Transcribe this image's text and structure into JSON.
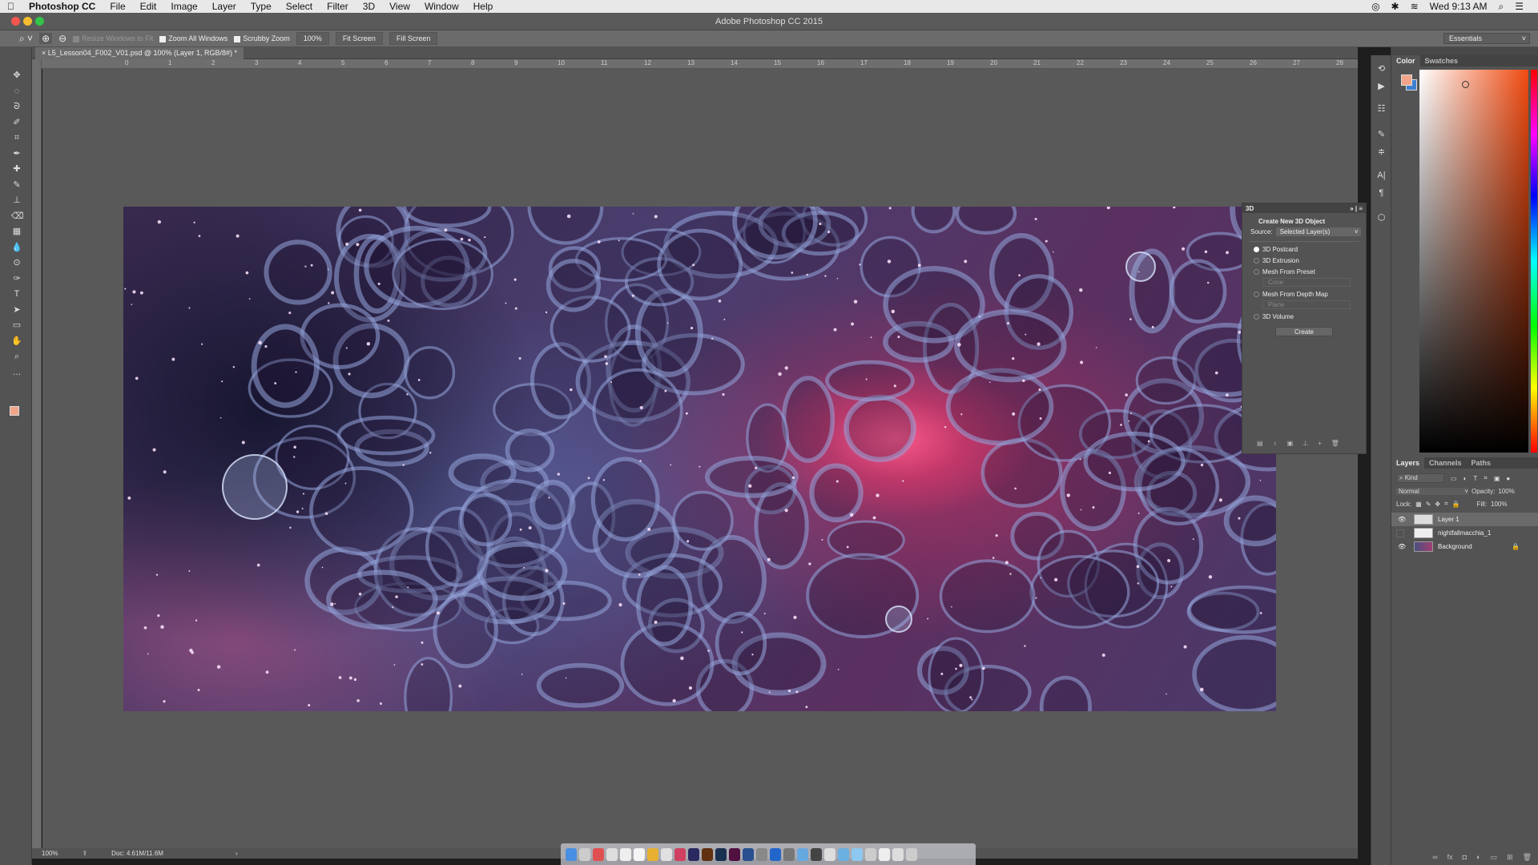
{
  "menubar": {
    "app": "Photoshop CC",
    "items": [
      "File",
      "Edit",
      "Image",
      "Layer",
      "Type",
      "Select",
      "Filter",
      "3D",
      "View",
      "Window",
      "Help"
    ],
    "clock": "Wed 9:13 AM"
  },
  "window": {
    "title": "Adobe Photoshop CC 2015"
  },
  "options": {
    "resize_windows": "Resize Windows to Fit",
    "zoom_all": "Zoom All Windows",
    "scrubby": "Scrubby Zoom",
    "zoom_value": "100%",
    "fit_screen": "Fit Screen",
    "fill_screen": "Fill Screen",
    "workspace": "Essentials"
  },
  "document": {
    "tab": "L5_Lesson04_F002_V01.psd @ 100% (Layer 1, RGB/8#) *"
  },
  "ruler": {
    "h": [
      "0",
      "1",
      "2",
      "3",
      "4",
      "5",
      "6",
      "7",
      "8",
      "9",
      "10",
      "11",
      "12",
      "13",
      "14",
      "15",
      "16",
      "17",
      "18",
      "19",
      "20",
      "21",
      "22",
      "23",
      "24",
      "25",
      "26",
      "27",
      "28"
    ]
  },
  "status": {
    "zoom": "100%",
    "doc": "Doc: 4.61M/11.6M",
    "arrow": "›"
  },
  "panel3d": {
    "tab": "3D",
    "heading": "Create New 3D Object",
    "source_label": "Source:",
    "source_value": "Selected Layer(s)",
    "options": [
      "3D Postcard",
      "3D Extrusion",
      "Mesh From Preset",
      "Mesh From Depth Map",
      "3D Volume"
    ],
    "selected": "3D Postcard",
    "preset": "Cone",
    "depth": "Plane",
    "create": "Create"
  },
  "color_panel": {
    "tabs": [
      "Color",
      "Swatches"
    ],
    "foreground": "#f2a58a",
    "background": "#3d7fd0"
  },
  "layers_panel": {
    "tabs": [
      "Layers",
      "Channels",
      "Paths"
    ],
    "filter": "Kind",
    "blend": "Normal",
    "opacity_label": "Opacity:",
    "opacity": "100%",
    "lock_label": "Lock:",
    "fill_label": "Fill:",
    "fill": "100%",
    "layers": [
      {
        "name": "Layer 1",
        "visible": true,
        "selected": true
      },
      {
        "name": "nightfallmacchia_1",
        "visible": false,
        "selected": false
      },
      {
        "name": "Background",
        "visible": true,
        "selected": false,
        "locked": true
      }
    ]
  }
}
